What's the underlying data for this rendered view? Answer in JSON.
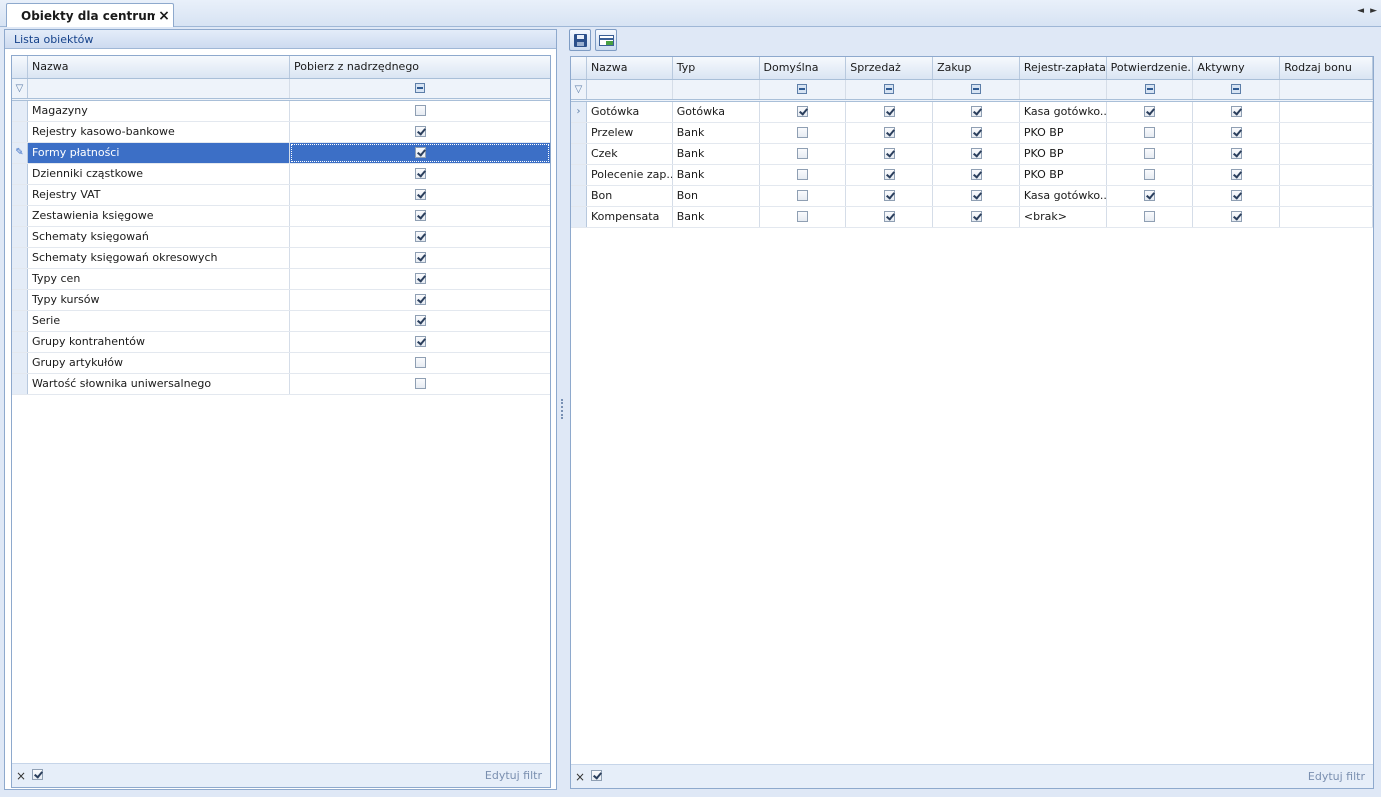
{
  "tab": {
    "title": "Obiekty dla centrum:...",
    "close_icon": "×"
  },
  "nav": {
    "left": "◄",
    "right": "►"
  },
  "left_panel": {
    "header": "Lista obiektów",
    "columns": [
      "Nazwa",
      "Pobierz z nadrzędnego"
    ],
    "rows": [
      {
        "name": "Magazyny",
        "checked": false
      },
      {
        "name": "Rejestry kasowo-bankowe",
        "checked": true
      },
      {
        "name": "Formy płatności",
        "checked": true,
        "selected": true
      },
      {
        "name": "Dzienniki cząstkowe",
        "checked": true
      },
      {
        "name": "Rejestry VAT",
        "checked": true
      },
      {
        "name": "Zestawienia księgowe",
        "checked": true
      },
      {
        "name": "Schematy księgowań",
        "checked": true
      },
      {
        "name": "Schematy księgowań okresowych",
        "checked": true
      },
      {
        "name": "Typy cen",
        "checked": true
      },
      {
        "name": "Typy kursów",
        "checked": true
      },
      {
        "name": "Serie",
        "checked": true
      },
      {
        "name": "Grupy kontrahentów",
        "checked": true
      },
      {
        "name": "Grupy artykułów",
        "checked": false
      },
      {
        "name": "Wartość słownika uniwersalnego",
        "checked": false
      }
    ],
    "footer": {
      "clear": "×",
      "edit_filter": "Edytuj filtr"
    }
  },
  "right_panel": {
    "toolbar": {
      "save_icon": "save-icon",
      "layout_icon": "grid-layout-icon"
    },
    "columns": [
      "Nazwa",
      "Typ",
      "Domyślna",
      "Sprzedaż",
      "Zakup",
      "Rejestr-zapłata",
      "Potwierdzenie...",
      "Aktywny",
      "Rodzaj bonu"
    ],
    "rows": [
      {
        "nazwa": "Gotówka",
        "typ": "Gotówka",
        "domyslna": true,
        "sprzedaz": true,
        "zakup": true,
        "rejestr": "Kasa gotówko...",
        "potwierdzenie": true,
        "aktywny": true,
        "rodzaj": "",
        "current": true
      },
      {
        "nazwa": "Przelew",
        "typ": "Bank",
        "domyslna": false,
        "sprzedaz": true,
        "zakup": true,
        "rejestr": "PKO BP",
        "potwierdzenie": false,
        "aktywny": true,
        "rodzaj": ""
      },
      {
        "nazwa": "Czek",
        "typ": "Bank",
        "domyslna": false,
        "sprzedaz": true,
        "zakup": true,
        "rejestr": "PKO BP",
        "potwierdzenie": false,
        "aktywny": true,
        "rodzaj": ""
      },
      {
        "nazwa": "Polecenie zap...",
        "typ": "Bank",
        "domyslna": false,
        "sprzedaz": true,
        "zakup": true,
        "rejestr": "PKO BP",
        "potwierdzenie": false,
        "aktywny": true,
        "rodzaj": ""
      },
      {
        "nazwa": "Bon",
        "typ": "Bon",
        "domyslna": false,
        "sprzedaz": true,
        "zakup": true,
        "rejestr": "Kasa gotówko...",
        "potwierdzenie": true,
        "aktywny": true,
        "rodzaj": ""
      },
      {
        "nazwa": "Kompensata",
        "typ": "Bank",
        "domyslna": false,
        "sprzedaz": true,
        "zakup": true,
        "rejestr": "<brak>",
        "potwierdzenie": false,
        "aktywny": true,
        "rodzaj": ""
      }
    ],
    "footer": {
      "clear": "×",
      "edit_filter": "Edytuj filtr"
    }
  }
}
